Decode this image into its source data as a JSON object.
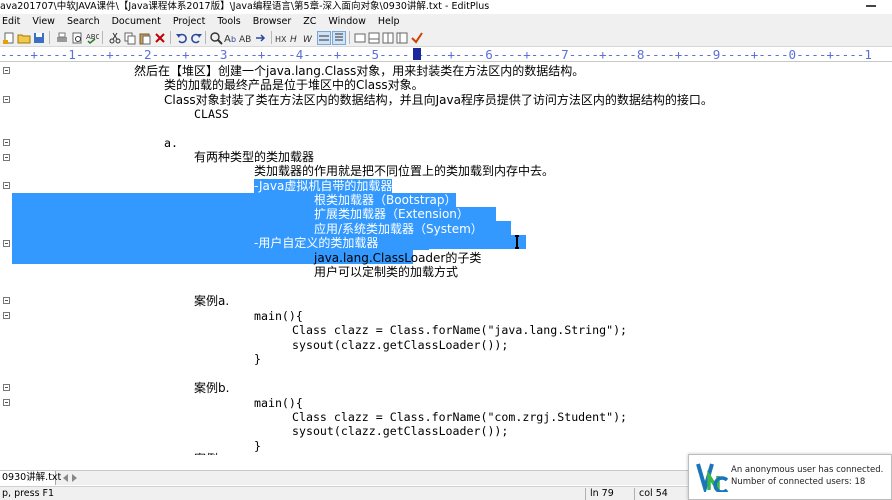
{
  "window": {
    "title": "ava201707\\中软JAVA课件\\【Java课程体系2017版】\\Java编程语言\\第5章-深入面向对象\\0930讲解.txt - EditPlus"
  },
  "menu": [
    "Edit",
    "View",
    "Search",
    "Document",
    "Project",
    "Tools",
    "Browser",
    "ZC",
    "Window",
    "Help"
  ],
  "ruler": {
    "text": "----+----1----+----2----+----3----+----4----+----5---- ----+----6----+----7----+----8----+----9----+----0----+----1"
  },
  "editor": {
    "lines": [
      "然后在【堆区】创建一个java.lang.Class对象，用来封装类在方法区内的数据结构。",
      "类的加载的最终产品是位于堆区中的Class对象。",
      "Class对象封装了类在方法区内的数据结构，并且向Java程序员提供了访问方法区内的数据结构的接口。",
      "CLASS",
      "a.",
      "有两种类型的类加载器",
      "类加载器的作用就是把不同位置上的类加载到内存中去。",
      "-Java虚拟机自带的加载器",
      "根类加载器（Bootstrap）",
      "扩展类加载器（Extension）",
      "应用/系统类加载器（System）",
      "-用户自定义的类加载器",
      "java.lang.ClassLoader的子类",
      "用户可以定制类的加载方式",
      "案例a.",
      "main(){",
      "Class clazz = Class.forName(\"java.lang.String\");",
      "sysout(clazz.getClassLoader());",
      "}",
      "案例b.",
      "main(){",
      "Class clazz = Class.forName(\"com.zrgj.Student\");",
      "sysout(clazz.getClassLoader());",
      "}",
      "案例"
    ]
  },
  "file_tab": {
    "label": "0930讲解.txt"
  },
  "status": {
    "help": "p, press F1",
    "line": "ln 79",
    "col": "col 54"
  },
  "vnc": {
    "line1": "An anonymous user has connected.",
    "line2": "Number of connected users: 18",
    "colors": {
      "v": "#1b75bb",
      "n": "#39b54a",
      "c": "#1b75bb"
    }
  },
  "colors": {
    "selection": "#3399ff",
    "ruler_text": "#5a70d8",
    "ruler_cursor": "#1a2a9a"
  }
}
